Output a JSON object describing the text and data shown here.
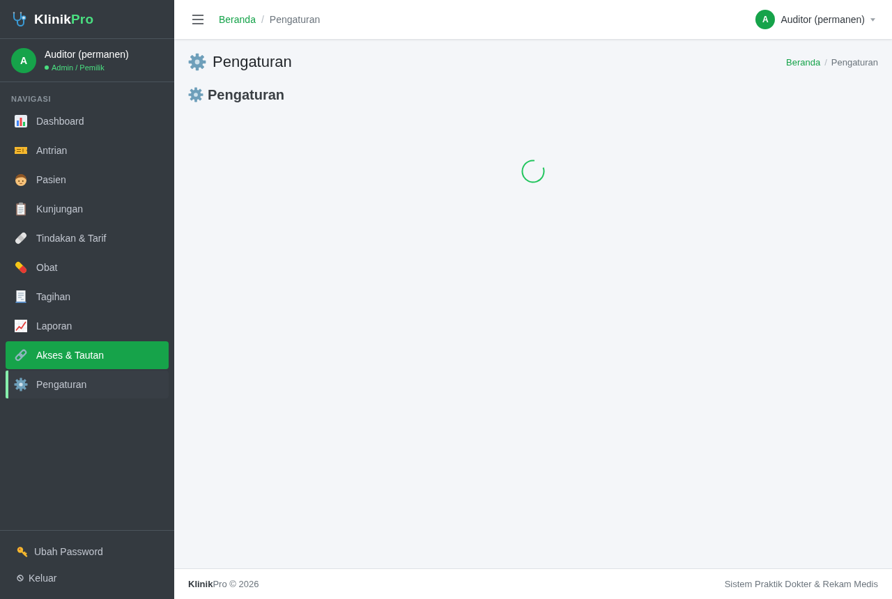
{
  "sidebar": {
    "brand": {
      "name": "Klinik",
      "accent": "Pro"
    },
    "user": {
      "avatar": "A",
      "name": "Auditor (permanen)",
      "role": "Admin / Pemilik",
      "online": true
    },
    "nav_heading": "NAVIGASI",
    "items": [
      {
        "label": "Dashboard",
        "selected": false,
        "highlighted": false
      },
      {
        "label": "Antrian",
        "selected": false,
        "highlighted": false
      },
      {
        "label": "Pasien",
        "selected": false,
        "highlighted": false
      },
      {
        "label": "Kunjungan",
        "selected": false,
        "highlighted": false
      },
      {
        "label": "Tindakan & Tarif",
        "selected": false,
        "highlighted": false
      },
      {
        "label": "Obat",
        "selected": false,
        "highlighted": false
      },
      {
        "label": "Tagihan",
        "selected": false,
        "highlighted": false
      },
      {
        "label": "Laporan",
        "selected": false,
        "highlighted": false
      },
      {
        "label": "Akses & Tautan",
        "selected": true,
        "highlighted": false
      },
      {
        "label": "Pengaturan",
        "selected": false,
        "highlighted": true
      }
    ],
    "bottom_links": [
      {
        "label": "Ubah Password"
      },
      {
        "label": "Keluar"
      }
    ]
  },
  "topbar": {
    "breadcrumb": {
      "separator": "/",
      "items": [
        {
          "label": "Beranda",
          "current": false
        },
        {
          "label": "Pengaturan",
          "current": true
        }
      ]
    },
    "user": {
      "avatar": "A",
      "name": "Auditor (permanen)"
    }
  },
  "page": {
    "title": "Pengaturan",
    "breadcrumb": {
      "separator": "/",
      "items": [
        {
          "label": "Beranda",
          "current": false
        },
        {
          "label": "Pengaturan",
          "current": true
        }
      ]
    },
    "card_title": "Pengaturan",
    "loading": true
  },
  "footer": {
    "left": "**Klinik**Pro © 2026",
    "right": "Sistem Praktik Dokter & Rekam Medis"
  }
}
